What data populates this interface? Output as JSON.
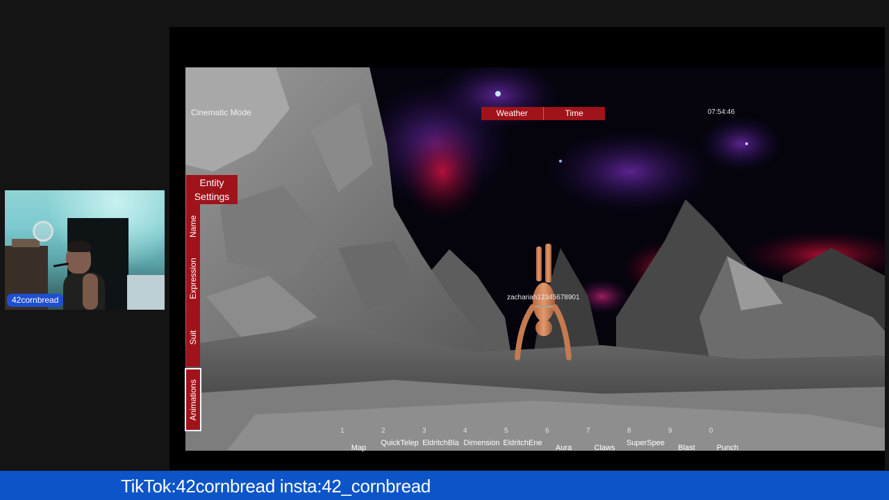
{
  "webcam": {
    "name_tag": "42cornbread"
  },
  "hud": {
    "cinematic_mode": "Cinematic Mode",
    "clock": "07:54:46",
    "topbar": [
      "Weather",
      "Time"
    ],
    "entity_settings_line1": "Entity",
    "entity_settings_line2": "Settings",
    "side_tabs": {
      "name": "Name",
      "expression": "Expression",
      "suit": "Suit",
      "animations": "Animations"
    },
    "player_name": "zachariah12345678901"
  },
  "hotbar": [
    {
      "key": "1",
      "label": "Map"
    },
    {
      "key": "2",
      "label": "QuickTelep"
    },
    {
      "key": "3",
      "label": "EldritchBla"
    },
    {
      "key": "4",
      "label": "Dimension"
    },
    {
      "key": "5",
      "label": "EldritchEne"
    },
    {
      "key": "6",
      "label": "Aura"
    },
    {
      "key": "7",
      "label": "Claws"
    },
    {
      "key": "8",
      "label": "SuperSpee"
    },
    {
      "key": "9",
      "label": "Blast"
    },
    {
      "key": "0",
      "label": "Punch"
    }
  ],
  "banner": {
    "text": "TikTok:42cornbread insta:42_cornbread"
  },
  "colors": {
    "hud_red": "#a0131a",
    "banner_blue": "#0b55c8",
    "name_tag_blue": "#1d4fd0"
  }
}
